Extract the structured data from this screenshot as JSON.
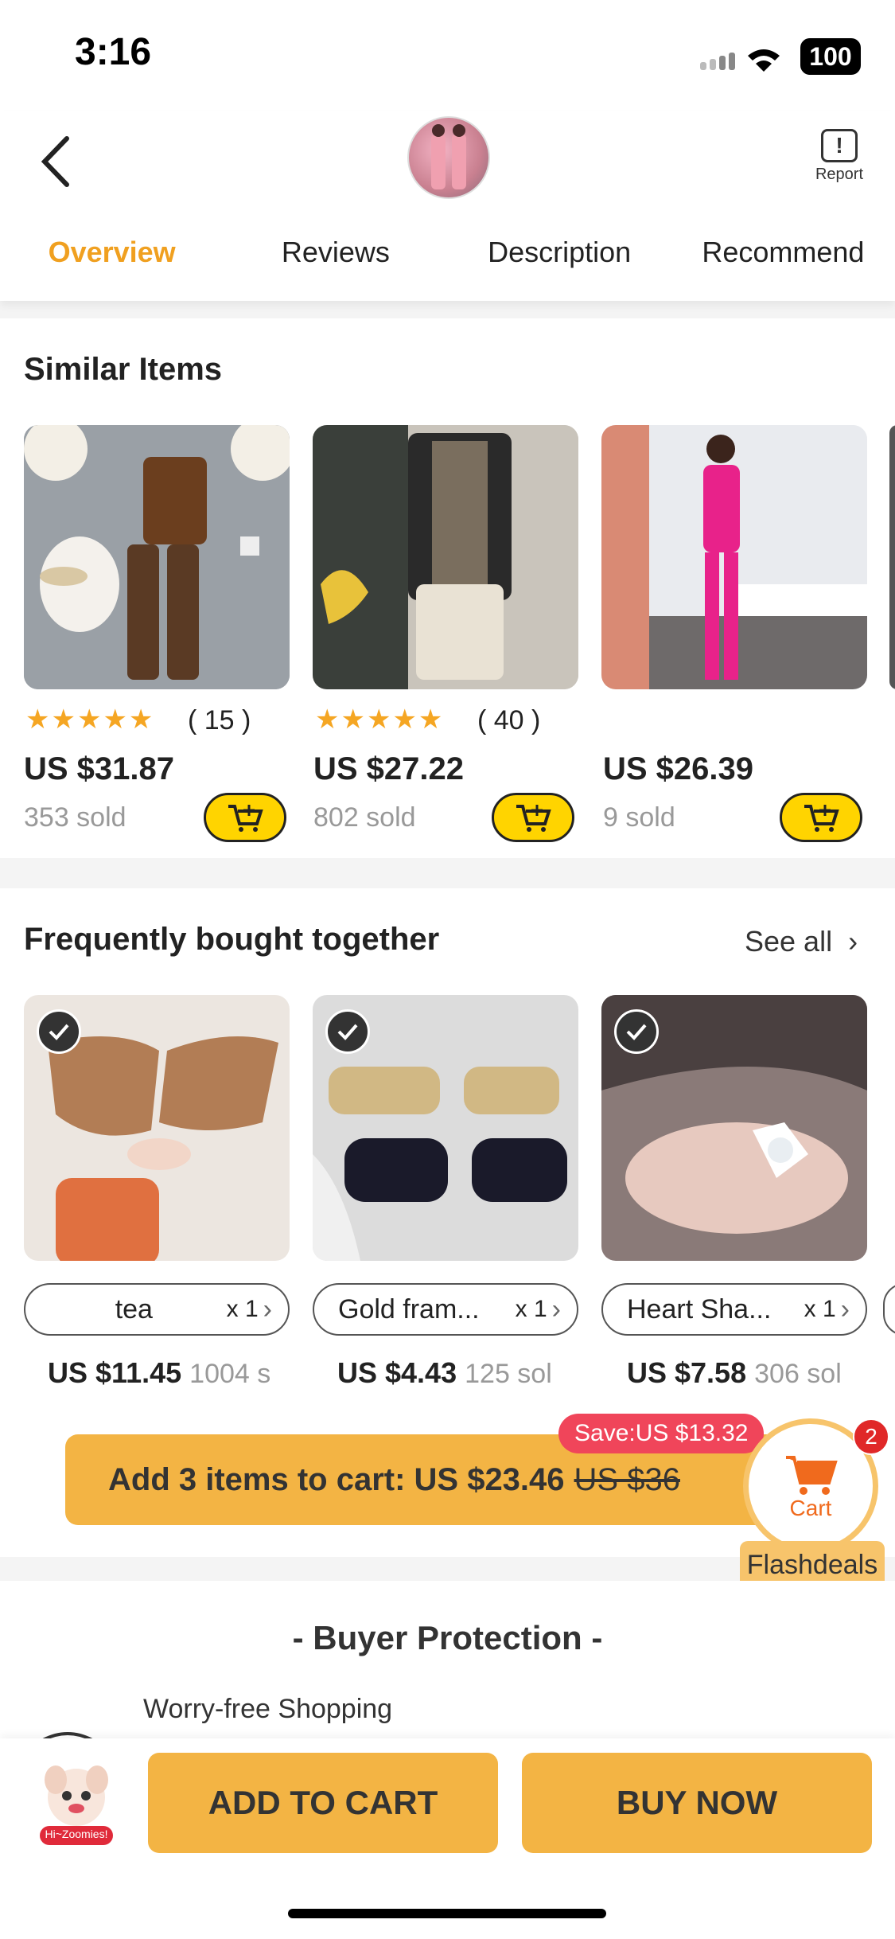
{
  "status": {
    "time": "3:16",
    "battery": "100"
  },
  "header": {
    "report_label": "Report"
  },
  "tabs": [
    "Overview",
    "Reviews",
    "Description",
    "Recommend"
  ],
  "similar": {
    "title": "Similar Items",
    "items": [
      {
        "rating_count": "( 15 )",
        "stars": 5,
        "price": "US $31.87",
        "sold": "353 sold"
      },
      {
        "rating_count": "( 40 )",
        "stars": 5,
        "price": "US $27.22",
        "sold": "802 sold"
      },
      {
        "rating_count": "",
        "stars": 0,
        "price": "US $26.39",
        "sold": "9 sold"
      }
    ]
  },
  "fbt": {
    "title": "Frequently bought together",
    "see_all": "See all",
    "items": [
      {
        "name": "tea",
        "qty": "x 1",
        "price": "US $11.45",
        "sold": "1004 s"
      },
      {
        "name": "Gold fram...",
        "qty": "x 1",
        "price": "US $4.43",
        "sold": "125 sol"
      },
      {
        "name": "Heart Sha...",
        "qty": "x 1",
        "price": "US $7.58",
        "sold": "306 sol"
      }
    ],
    "save": "Save:US $13.32",
    "add_label": "Add 3 items to cart: US $23.46",
    "orig_price": "US $36"
  },
  "cart_fab": {
    "label": "Cart",
    "badge": "2",
    "flash": "Flashdeals"
  },
  "protection": {
    "title": "- Buyer Protection -",
    "line1": "Worry-free Shopping"
  },
  "bottom": {
    "add_to_cart": "ADD TO CART",
    "buy_now": "BUY NOW",
    "mascot_label": "Hi~Zoomies!"
  },
  "colors": {
    "accent": "#f0a020",
    "button": "#f3b444",
    "cart_yellow": "#ffd400",
    "save_red": "#f0455a"
  }
}
